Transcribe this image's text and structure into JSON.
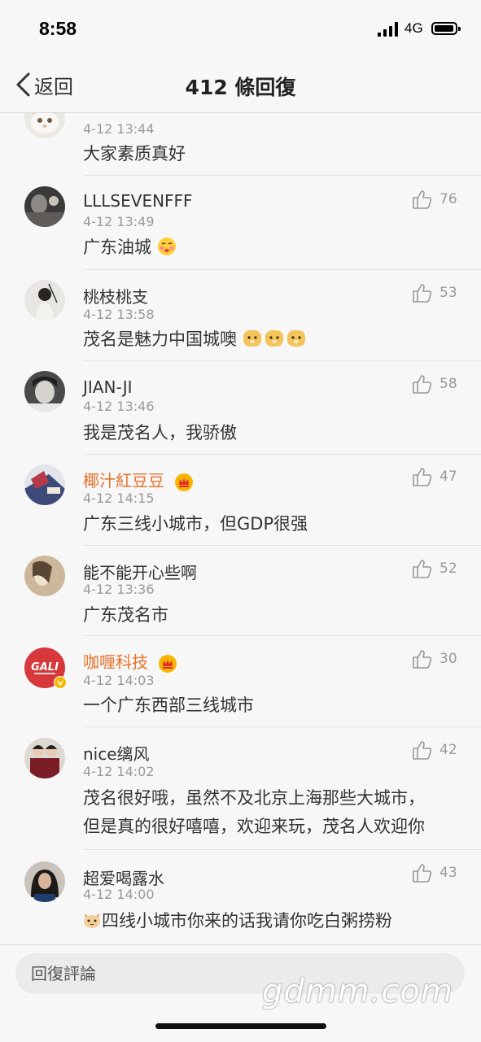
{
  "status_bar": {
    "time": "8:58",
    "network": "4G"
  },
  "nav": {
    "back_label": "返回",
    "title": "412 條回復"
  },
  "comments": [
    {
      "username": "",
      "time": "4-12 13:44",
      "text": "大家素质真好",
      "likes": "",
      "avatar": "cat-avatar"
    },
    {
      "username": "LLLSEVENFFF",
      "time": "4-12 13:49",
      "text": "广东油城",
      "likes": "76",
      "avatar": "person-avatar",
      "emoji": "blush-emoji"
    },
    {
      "username": "桃枝桃支",
      "time": "4-12 13:58",
      "text": "茂名是魅力中国城噢",
      "likes": "53",
      "avatar": "person-avatar",
      "emoji": "doge-emoji-x3"
    },
    {
      "username": "JIAN-JI",
      "time": "4-12 13:46",
      "text": "我是茂名人，我骄傲",
      "likes": "58",
      "avatar": "person-avatar"
    },
    {
      "username": "椰汁紅豆豆",
      "time": "4-12 14:15",
      "text": "广东三线小城市，但GDP很强",
      "likes": "47",
      "avatar": "art-avatar",
      "vip": true
    },
    {
      "username": "能不能开心些啊",
      "time": "4-12 13:36",
      "text": "广东茂名市",
      "likes": "52",
      "avatar": "person-avatar"
    },
    {
      "username": "咖喱科技",
      "time": "4-12 14:03",
      "text": "一个广东西部三线城市",
      "likes": "30",
      "avatar": "gali-logo-avatar",
      "vip": true,
      "avatar_text": "GALI"
    },
    {
      "username": "nice缡风",
      "time": "4-12 14:02",
      "text": "茂名很好哦，虽然不及北京上海那些大城市，",
      "text2": "但是真的很好嘻嘻，欢迎来玩，茂名人欢迎你",
      "likes": "42",
      "avatar": "couple-avatar"
    },
    {
      "username": "超爱喝露水",
      "time": "4-12 14:00",
      "text": "四线小城市你来的话我请你吃白粥捞粉",
      "likes": "43",
      "avatar": "person-avatar",
      "emoji": "cat-emoji"
    }
  ],
  "reply_input": {
    "placeholder": "回復評論"
  },
  "watermark": "gdmm.com",
  "colors": {
    "vip_name": "#e8712b",
    "meta_gray": "#999999",
    "background": "#f7f7f7"
  }
}
